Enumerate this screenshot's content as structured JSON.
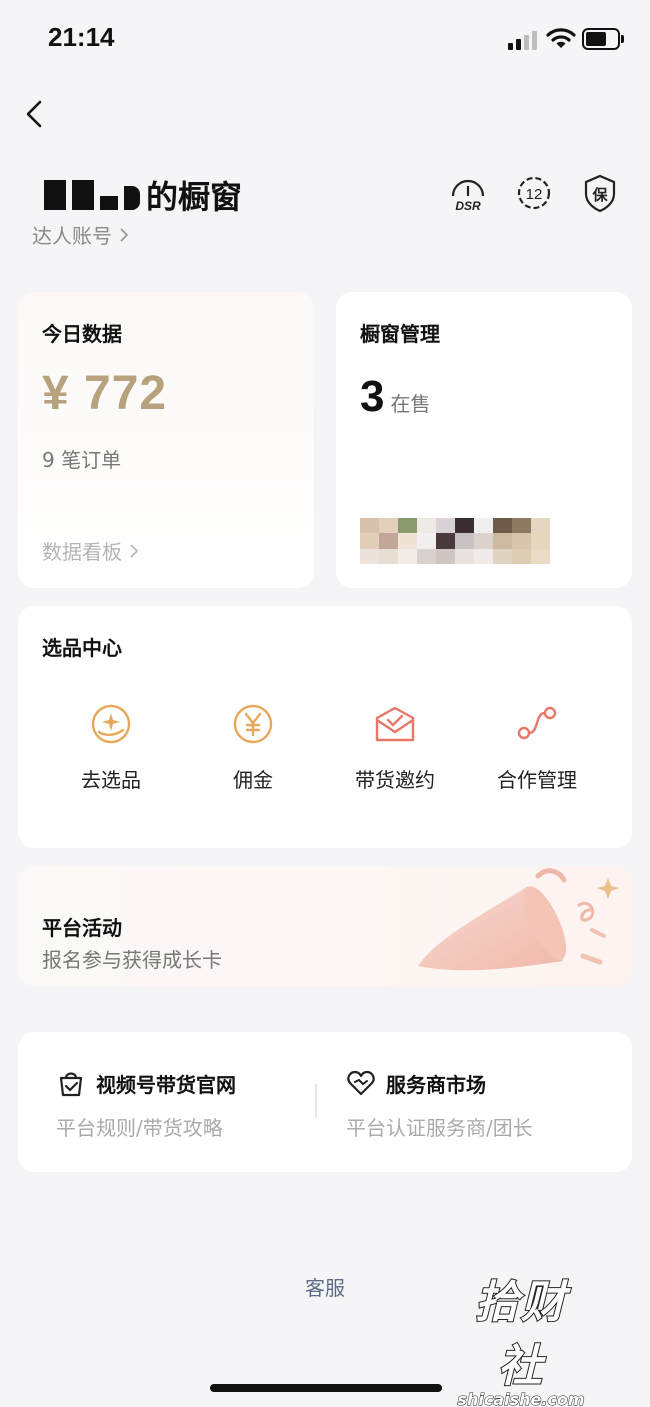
{
  "status_bar": {
    "time": "21:14"
  },
  "header": {
    "title_suffix": "的橱窗",
    "account_label": "达人账号",
    "icons": [
      "dsr-gauge-icon",
      "level-12-badge-icon",
      "guarantee-shield-icon"
    ],
    "dsr_text": "DSR",
    "level_text": "12",
    "shield_text": "保"
  },
  "today_card": {
    "title": "今日数据",
    "amount": "¥ 772",
    "orders": "9 笔订单",
    "dashboard_link": "数据看板"
  },
  "window_card": {
    "title": "橱窗管理",
    "count": "3",
    "count_label": "在售"
  },
  "select_center": {
    "title": "选品中心",
    "items": [
      {
        "label": "去选品",
        "icon": "hand-sparkle-icon"
      },
      {
        "label": "佣金",
        "icon": "yen-coin-icon"
      },
      {
        "label": "带货邀约",
        "icon": "envelope-check-icon"
      },
      {
        "label": "合作管理",
        "icon": "route-nodes-icon"
      }
    ]
  },
  "activity": {
    "title": "平台活动",
    "subtitle": "报名参与获得成长卡"
  },
  "links": [
    {
      "title": "视频号带货官网",
      "subtitle": "平台规则/带货攻略",
      "icon": "bag-check-icon"
    },
    {
      "title": "服务商市场",
      "subtitle": "平台认证服务商/团长",
      "icon": "heart-handshake-icon"
    }
  ],
  "footer": {
    "service_label": "客服"
  },
  "watermark": {
    "cn": "拾财社",
    "en": "shicaishe.com"
  },
  "colors": {
    "accent_gold": "#b8a27e",
    "icon_orange": "#e8a85c",
    "icon_red": "#e6786a",
    "link_blue": "#5d6b88"
  }
}
